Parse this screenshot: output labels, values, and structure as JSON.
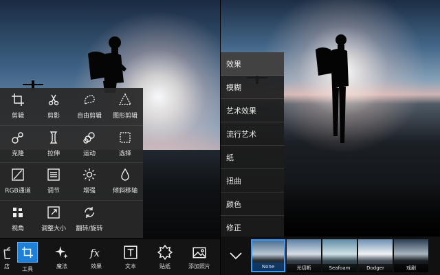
{
  "left_panel": {
    "tools": [
      [
        {
          "label": "剪辑",
          "icon": "crop-icon"
        },
        {
          "label": "剪影",
          "icon": "cutout-icon"
        },
        {
          "label": "自由剪辑",
          "icon": "free-crop-icon"
        },
        {
          "label": "图形剪辑",
          "icon": "shape-crop-icon"
        }
      ],
      [
        {
          "label": "克隆",
          "icon": "clone-icon"
        },
        {
          "label": "拉伸",
          "icon": "stretch-icon"
        },
        {
          "label": "运动",
          "icon": "motion-icon"
        },
        {
          "label": "选择",
          "icon": "select-icon"
        }
      ],
      [
        {
          "label": "RGB通道",
          "icon": "rgb-curves-icon"
        },
        {
          "label": "调节",
          "icon": "adjust-icon"
        },
        {
          "label": "增强",
          "icon": "enhance-icon"
        },
        {
          "label": "倾斜移轴",
          "icon": "tilt-shift-icon"
        }
      ],
      [
        {
          "label": "视角",
          "icon": "perspective-icon"
        },
        {
          "label": "调整大小",
          "icon": "resize-icon"
        },
        {
          "label": "翻转/旋转",
          "icon": "flip-rotate-icon"
        }
      ]
    ],
    "toolbar": [
      {
        "label": "店",
        "icon": "store-icon"
      },
      {
        "label": "工具",
        "icon": "tools-icon",
        "active": true
      },
      {
        "label": "魔法",
        "icon": "magic-icon"
      },
      {
        "label": "效果",
        "icon": "fx-icon"
      },
      {
        "label": "文本",
        "icon": "text-icon"
      },
      {
        "label": "贴纸",
        "icon": "sticker-icon"
      },
      {
        "label": "添加照片",
        "icon": "add-photo-icon"
      }
    ]
  },
  "right_panel": {
    "effect_categories": [
      "效果",
      "模糊",
      "艺术效果",
      "流行艺术",
      "纸",
      "扭曲",
      "颜色",
      "修正"
    ],
    "selected_category": "效果",
    "filters": [
      {
        "label": "None",
        "selected": true
      },
      {
        "label": "光切断"
      },
      {
        "label": "Seafoam"
      },
      {
        "label": "Dodger"
      },
      {
        "label": "戏剧"
      }
    ]
  },
  "colors": {
    "accent": "#1e7fd6",
    "panel_bg": "#282828",
    "toolbar_bg": "#141414"
  }
}
